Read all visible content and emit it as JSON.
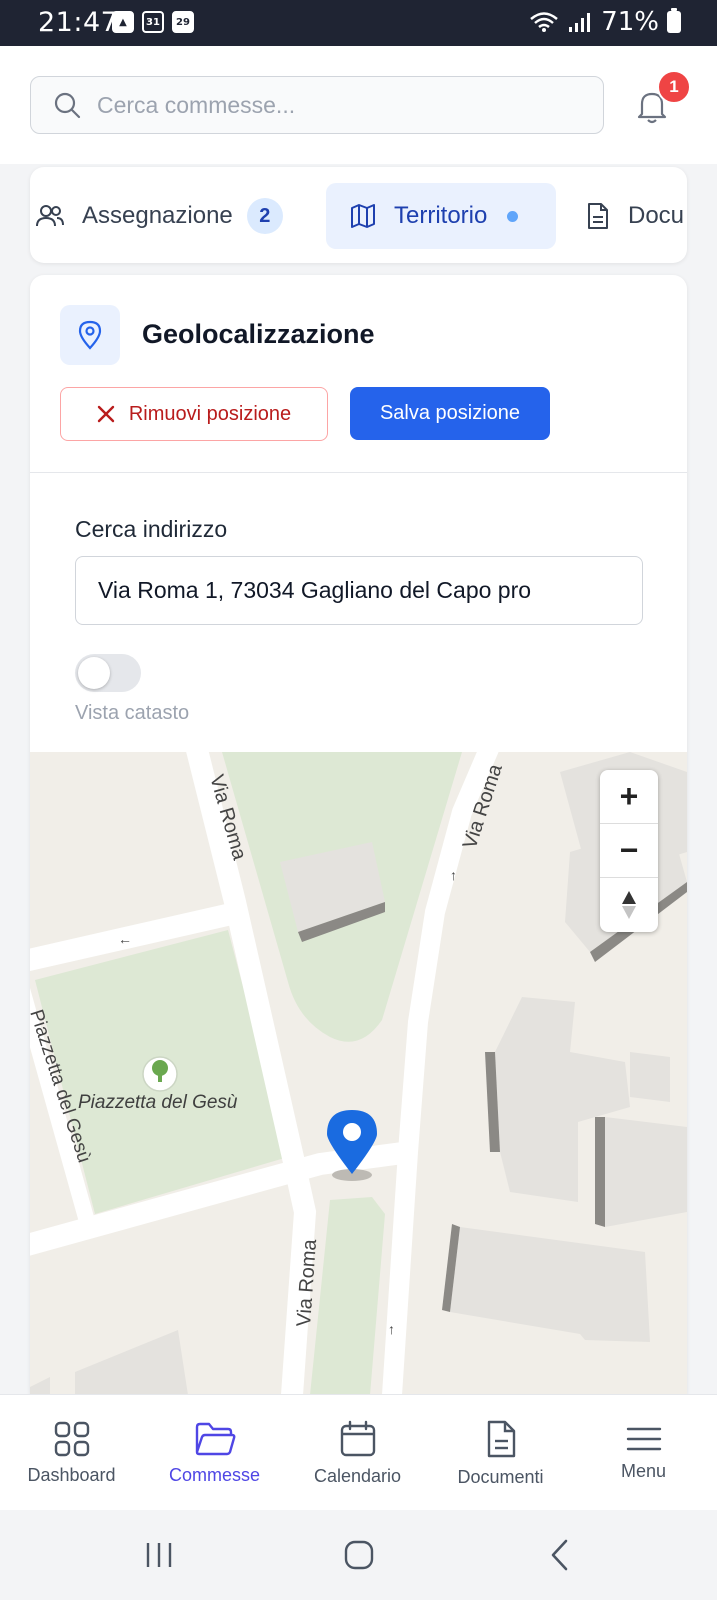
{
  "status_bar": {
    "time": "21:47",
    "battery": "71%",
    "icons": [
      "gallery-icon",
      "calendar-31-icon",
      "calendar-29-icon",
      "wifi-icon",
      "signal-icon",
      "battery-icon"
    ],
    "cal1": "31",
    "cal2": "29"
  },
  "header": {
    "search_placeholder": "Cerca commesse...",
    "notifications_count": "1"
  },
  "tabs": [
    {
      "label": "Assegnazione",
      "count": "2",
      "icon": "users-icon"
    },
    {
      "label": "Territorio",
      "icon": "map-icon",
      "active": true
    },
    {
      "label": "Docu",
      "icon": "document-icon"
    }
  ],
  "geolocation": {
    "title": "Geolocalizzazione",
    "remove_label": "Rimuovi posizione",
    "save_label": "Salva posizione",
    "address_label": "Cerca indirizzo",
    "address_value": "Via Roma 1, 73034 Gagliano del Capo pro",
    "toggle_label": "Vista catasto",
    "toggle_on": false
  },
  "map": {
    "labels": {
      "via_roma_top_left": "Via Roma",
      "via_roma_top_right": "Via Roma",
      "via_roma_bottom": "Via Roma",
      "piazzetta_street": "Piazzetta del Gesù",
      "park_name": "Piazzetta del Gesù"
    },
    "zoom_in": "+",
    "zoom_out": "−",
    "compass": "compass-icon",
    "colors": {
      "marker": "#1a6be0",
      "park": "#dde8d4",
      "road": "#ffffff",
      "ground": "#f1eee8"
    }
  },
  "bottom_nav": [
    {
      "label": "Dashboard",
      "icon": "grid-icon"
    },
    {
      "label": "Commesse",
      "icon": "folder-icon",
      "active": true
    },
    {
      "label": "Calendario",
      "icon": "calendar-icon"
    },
    {
      "label": "Documenti",
      "icon": "document-icon"
    },
    {
      "label": "Menu",
      "icon": "hamburger-icon"
    }
  ],
  "colors": {
    "primary": "#2563eb",
    "danger": "#b91c1c",
    "active_nav": "#4f46e5"
  }
}
